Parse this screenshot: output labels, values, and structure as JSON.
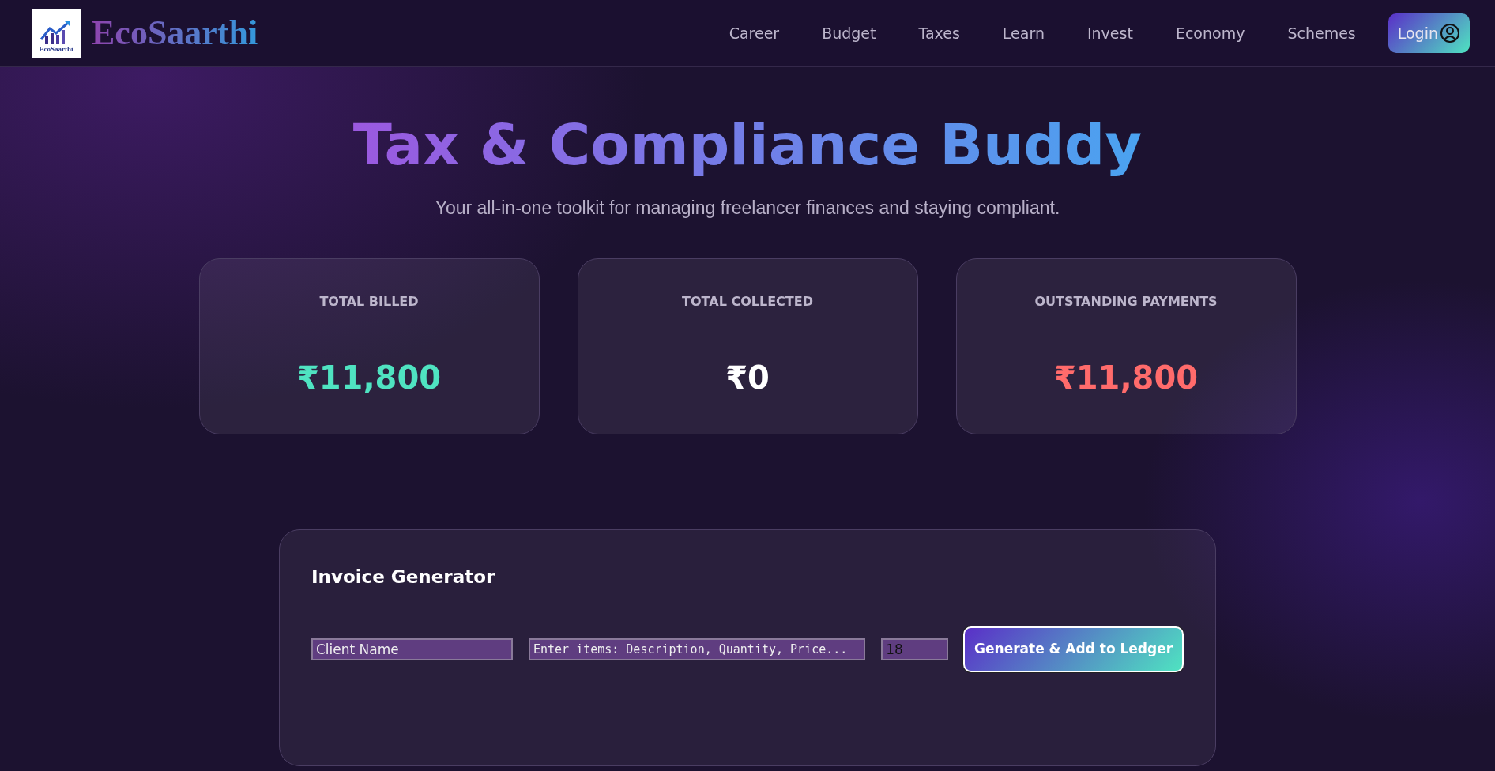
{
  "navbar": {
    "brand": "EcoSaarthi",
    "logo_caption": "EcoSaarthi",
    "links": [
      {
        "label": "Career"
      },
      {
        "label": "Budget"
      },
      {
        "label": "Taxes"
      },
      {
        "label": "Learn"
      },
      {
        "label": "Invest"
      },
      {
        "label": "Economy"
      },
      {
        "label": "Schemes"
      }
    ],
    "login": "Login"
  },
  "hero": {
    "title": "Tax & Compliance Buddy",
    "subtitle": "Your all-in-one toolkit for managing freelancer finances and staying compliant."
  },
  "stats": [
    {
      "label": "TOTAL BILLED",
      "value": "₹11,800",
      "color": "#4fe3c1"
    },
    {
      "label": "TOTAL COLLECTED",
      "value": "₹0",
      "color": "#ffffff"
    },
    {
      "label": "OUTSTANDING PAYMENTS",
      "value": "₹11,800",
      "color": "#ff6b6b"
    }
  ],
  "invoice": {
    "title": "Invoice Generator",
    "client": {
      "placeholder": "Client Name"
    },
    "items": {
      "placeholder": "Enter items: Description, Quantity, Price..."
    },
    "gst": {
      "value": "18"
    },
    "button": "Generate & Add to Ledger"
  }
}
